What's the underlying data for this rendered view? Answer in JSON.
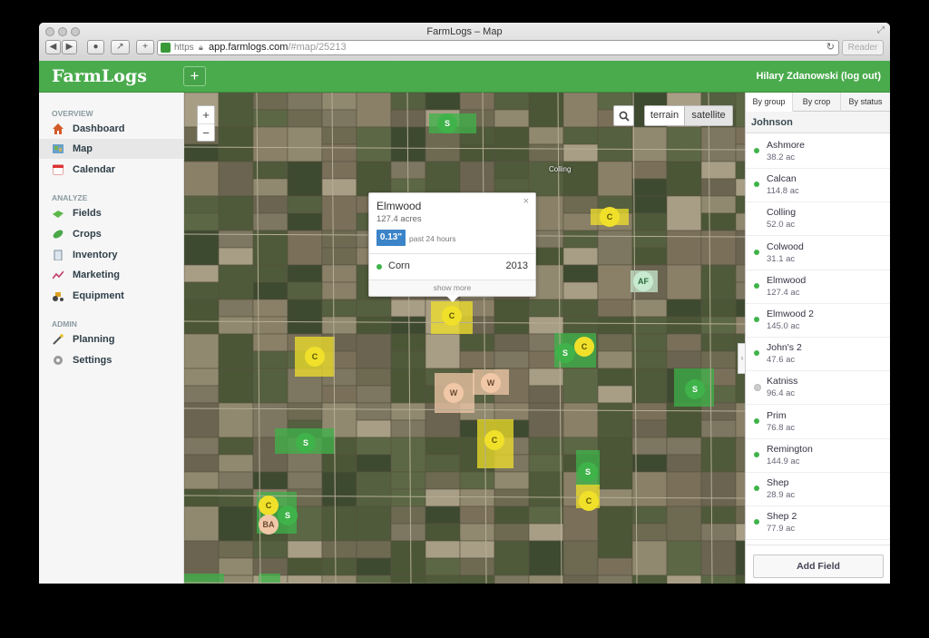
{
  "browser": {
    "window_title": "FarmLogs – Map",
    "url_scheme": "https",
    "url_host": "app.farmlogs.com",
    "url_path": "/#map/25213",
    "reader_label": "Reader"
  },
  "app": {
    "logo": "FarmLogs",
    "add_label": "+",
    "user_label": "Hilary Zdanowski (log out)"
  },
  "sidebar": {
    "sections": [
      {
        "title": "OVERVIEW",
        "items": [
          {
            "label": "Dashboard",
            "icon": "house-icon"
          },
          {
            "label": "Map",
            "icon": "map-icon"
          },
          {
            "label": "Calendar",
            "icon": "calendar-icon"
          }
        ]
      },
      {
        "title": "ANALYZE",
        "items": [
          {
            "label": "Fields",
            "icon": "field-icon"
          },
          {
            "label": "Crops",
            "icon": "leaf-icon"
          },
          {
            "label": "Inventory",
            "icon": "inventory-icon"
          },
          {
            "label": "Marketing",
            "icon": "chart-icon"
          },
          {
            "label": "Equipment",
            "icon": "tractor-icon"
          }
        ]
      },
      {
        "title": "ADMIN",
        "items": [
          {
            "label": "Planning",
            "icon": "wand-icon"
          },
          {
            "label": "Settings",
            "icon": "gear-icon"
          }
        ]
      }
    ],
    "active": "Map"
  },
  "map": {
    "zoom_in": "+",
    "zoom_out": "−",
    "type_terrain": "terrain",
    "type_satellite": "satellite",
    "selected_type": "satellite",
    "town_label": "Colling",
    "markers": [
      "S",
      "C",
      "AF",
      "C",
      "C",
      "S",
      "C",
      "W",
      "W",
      "S",
      "C",
      "S",
      "S",
      "C",
      "C",
      "BA",
      "S"
    ],
    "popup": {
      "name": "Elmwood",
      "acres": "127.4 acres",
      "rain": "0.13\"",
      "rain_period": "past 24 hours",
      "crop": "Corn",
      "year": "2013",
      "show_more": "show more",
      "close": "×"
    }
  },
  "panel": {
    "tabs": [
      "By group",
      "By crop",
      "By status"
    ],
    "active_tab": "By group",
    "group": "Johnson",
    "fields": [
      {
        "name": "Ashmore",
        "acres": "38.2 ac",
        "status": "green"
      },
      {
        "name": "Calcan",
        "acres": "114.8 ac",
        "status": "green"
      },
      {
        "name": "Colling",
        "acres": "52.0 ac",
        "status": "none"
      },
      {
        "name": "Colwood",
        "acres": "31.1 ac",
        "status": "green"
      },
      {
        "name": "Elmwood",
        "acres": "127.4 ac",
        "status": "green"
      },
      {
        "name": "Elmwood 2",
        "acres": "145.0 ac",
        "status": "green"
      },
      {
        "name": "John's 2",
        "acres": "47.6 ac",
        "status": "green"
      },
      {
        "name": "Katniss",
        "acres": "96.4 ac",
        "status": "gray"
      },
      {
        "name": "Prim",
        "acres": "76.8 ac",
        "status": "green"
      },
      {
        "name": "Remington",
        "acres": "144.9 ac",
        "status": "green"
      },
      {
        "name": "Shep",
        "acres": "28.9 ac",
        "status": "green"
      },
      {
        "name": "Shep 2",
        "acres": "77.9 ac",
        "status": "green"
      }
    ],
    "add_field_label": "Add Field"
  },
  "colors": {
    "brand": "#4aab4d",
    "status_green": "#3fb34a",
    "status_gray": "#cccccc",
    "rain_badge": "#3b84c8"
  }
}
